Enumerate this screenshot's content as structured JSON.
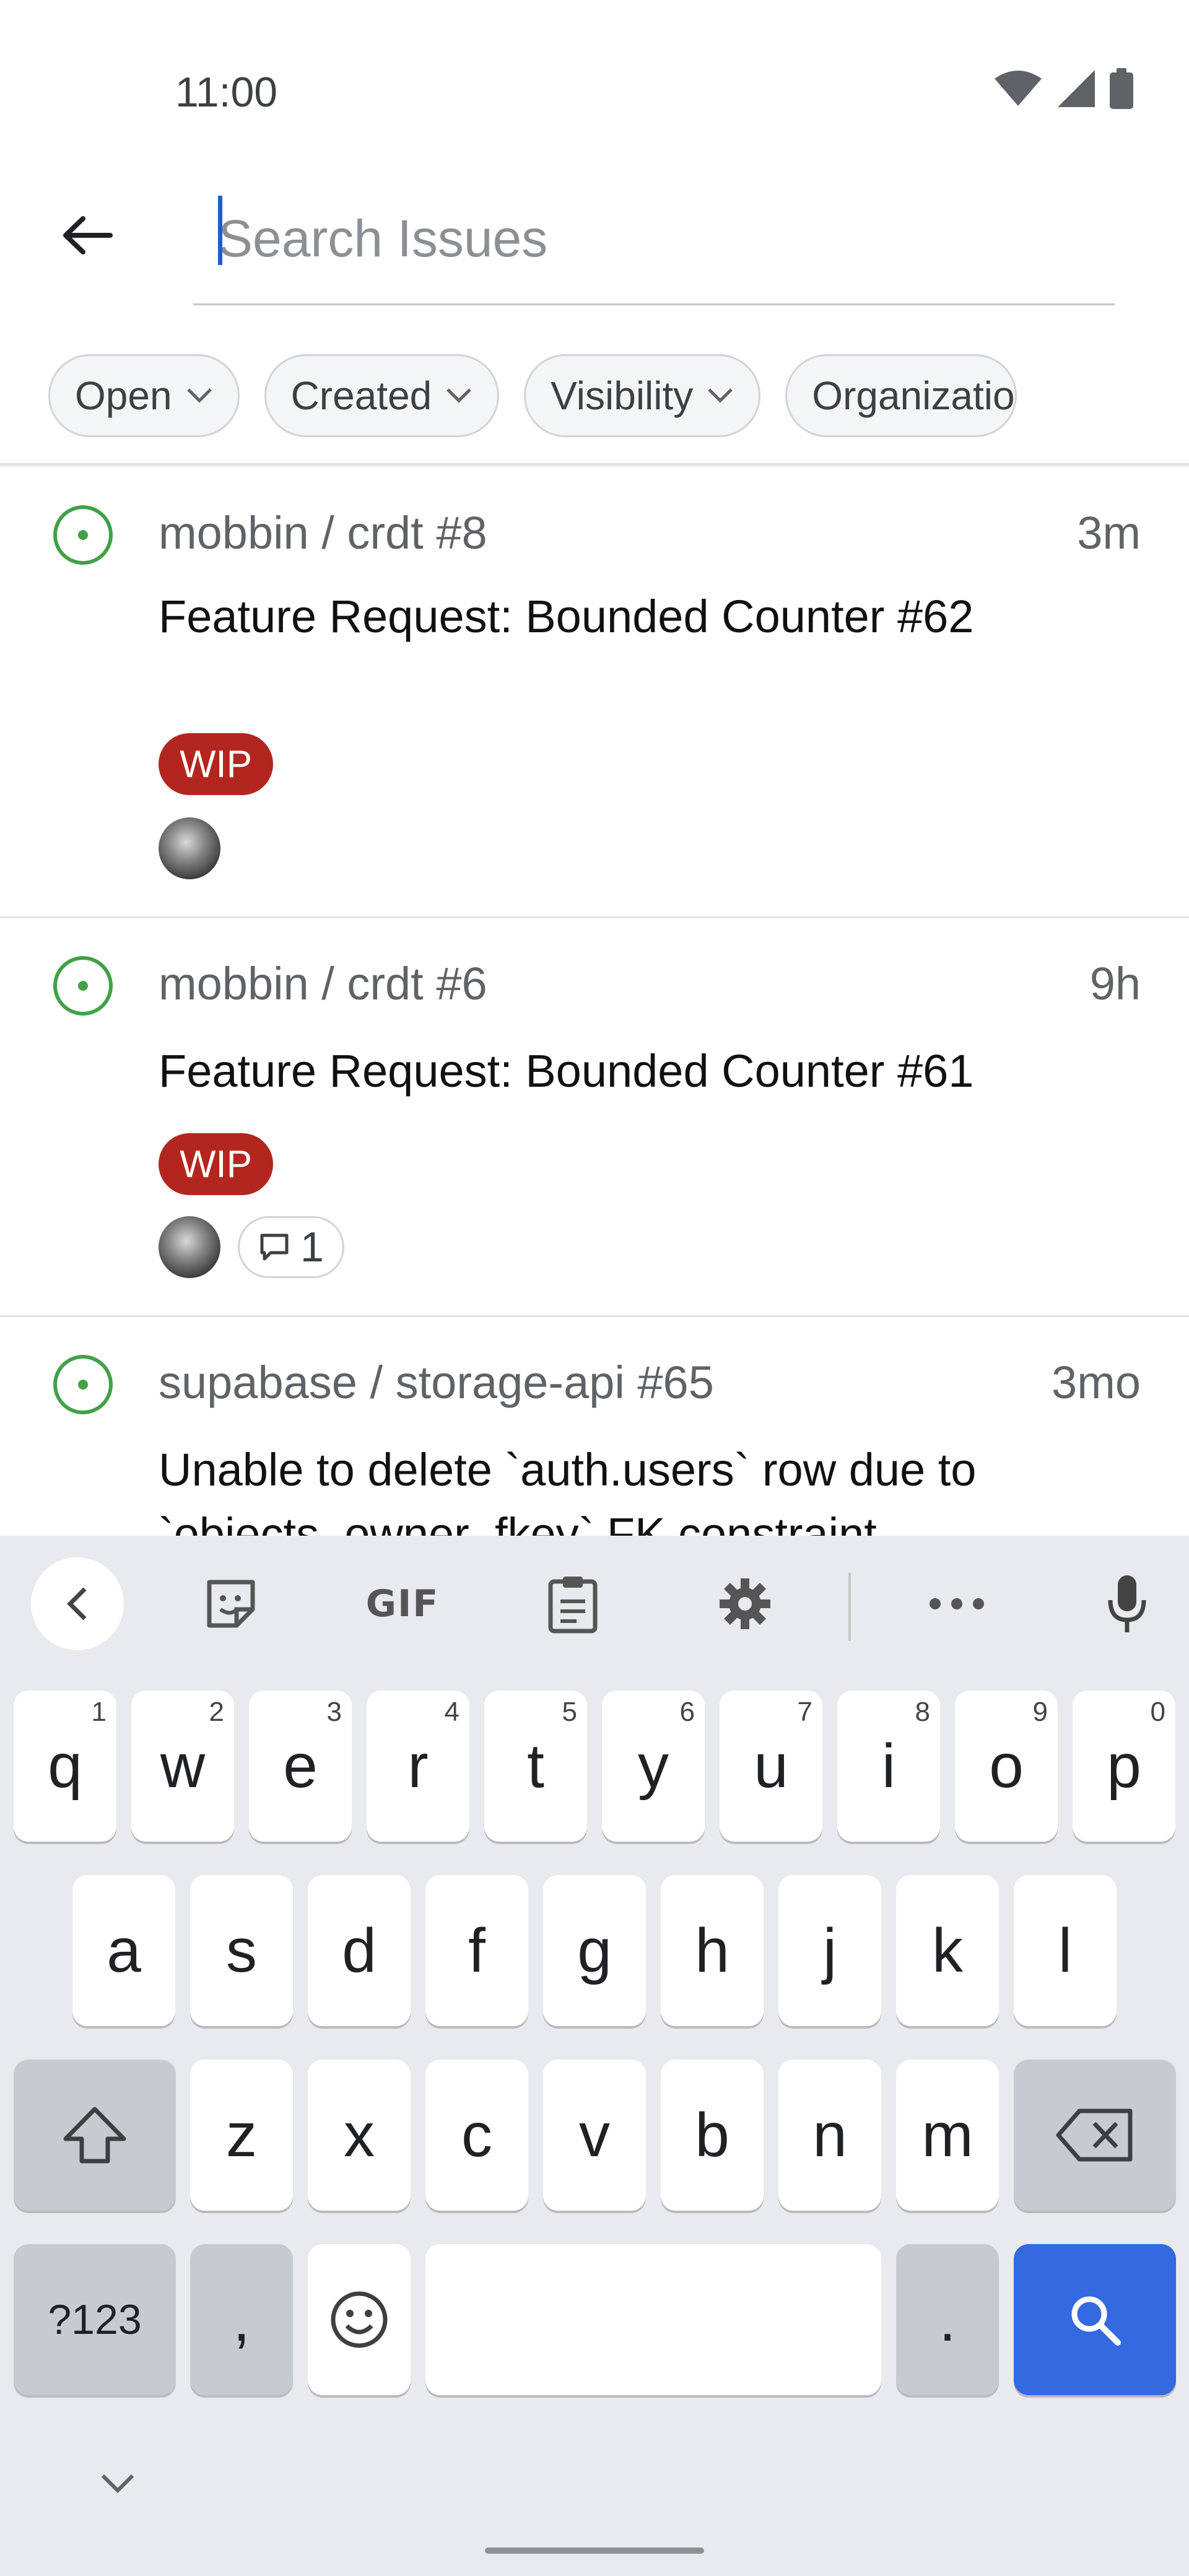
{
  "status_bar": {
    "time": "11:00"
  },
  "search": {
    "placeholder": "Search Issues",
    "value": ""
  },
  "filters": [
    {
      "label": "Open"
    },
    {
      "label": "Created"
    },
    {
      "label": "Visibility"
    },
    {
      "label": "Organizatio"
    }
  ],
  "issues": [
    {
      "repo": "mobbin / crdt #8",
      "age": "3m",
      "title": "Feature Request: Bounded Counter #62",
      "label": "WIP",
      "comments": ""
    },
    {
      "repo": "mobbin / crdt #6",
      "age": "9h",
      "title": "Feature Request: Bounded Counter #61",
      "label": "WIP",
      "comments": "1"
    },
    {
      "repo": "supabase / storage-api #65",
      "age": "3mo",
      "title": "Unable to delete `auth.users` row due to `objects_owner_fkey` FK constraint",
      "label": "",
      "comments": ""
    }
  ],
  "keyboard": {
    "toolbar": {
      "gif": "GIF"
    },
    "row1": [
      {
        "k": "q",
        "h": "1"
      },
      {
        "k": "w",
        "h": "2"
      },
      {
        "k": "e",
        "h": "3"
      },
      {
        "k": "r",
        "h": "4"
      },
      {
        "k": "t",
        "h": "5"
      },
      {
        "k": "y",
        "h": "6"
      },
      {
        "k": "u",
        "h": "7"
      },
      {
        "k": "i",
        "h": "8"
      },
      {
        "k": "o",
        "h": "9"
      },
      {
        "k": "p",
        "h": "0"
      }
    ],
    "row2": [
      "a",
      "s",
      "d",
      "f",
      "g",
      "h",
      "j",
      "k",
      "l"
    ],
    "row3": [
      "z",
      "x",
      "c",
      "v",
      "b",
      "n",
      "m"
    ],
    "symbols_label": "?123",
    "comma": ",",
    "period": "."
  },
  "colors": {
    "accent_blue": "#3569e0",
    "wip_red": "#b3261e",
    "open_green": "#43a047"
  }
}
